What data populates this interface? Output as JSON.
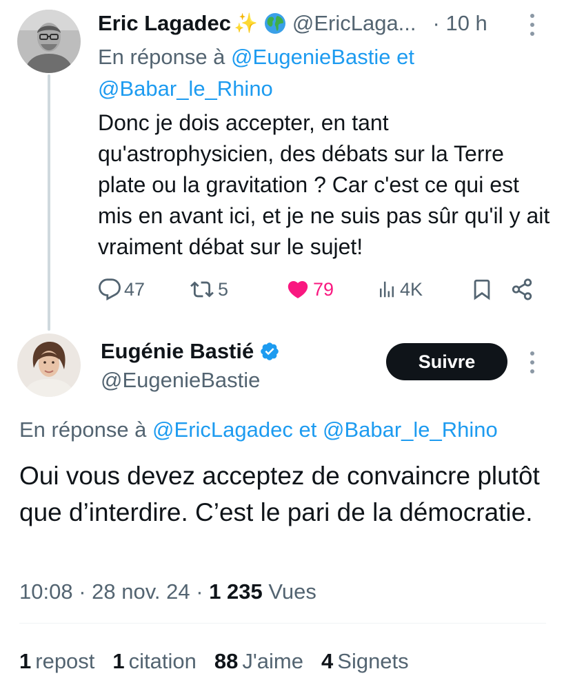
{
  "reply_tweet": {
    "author_name": "Eric Lagadec",
    "sparkles_emoji": "✨",
    "author_handle": "@EricLaga...",
    "time": "· 10 h",
    "in_reply_prefix": "En réponse à",
    "mention_1": "@EugenieBastie",
    "mention_join": "et",
    "mention_2": "@Babar_le_Rhino",
    "text": "Donc je dois accepter, en tant qu'astrophysicien, des débats sur la Terre plate ou la gravitation ? Car c'est ce qui est mis en avant ici,  et  je ne suis pas sûr qu'il y ait vraiment débat sur le sujet!",
    "replies": "47",
    "reposts": "5",
    "likes": "79",
    "views": "4K",
    "icons": [
      "reply-icon",
      "repost-icon",
      "heart-icon",
      "views-icon",
      "bookmark-icon",
      "share-icon",
      "more-icon"
    ]
  },
  "main_tweet": {
    "author_name": "Eugénie Bastié",
    "author_handle": "@EugenieBastie",
    "follow_label": "Suivre",
    "in_reply_prefix": "En réponse à",
    "mention_1": "@EricLagadec",
    "mention_join": "et",
    "mention_2": "@Babar_le_Rhino",
    "text": "Oui vous devez acceptez de convaincre plutôt que d’interdire. C’est le pari de la démocratie.",
    "time": "10:08",
    "date": "28 nov. 24",
    "views_count": "1 235",
    "views_label": "Vues",
    "stats": [
      {
        "num": "1",
        "label": "repost"
      },
      {
        "num": "1",
        "label": "citation"
      },
      {
        "num": "88",
        "label": "J'aime"
      },
      {
        "num": "4",
        "label": "Signets"
      }
    ]
  },
  "colors": {
    "accent": "#1d9bf0",
    "like": "#f91880",
    "muted": "#536471",
    "text": "#0f1419",
    "thread_line": "#cfd9de"
  }
}
